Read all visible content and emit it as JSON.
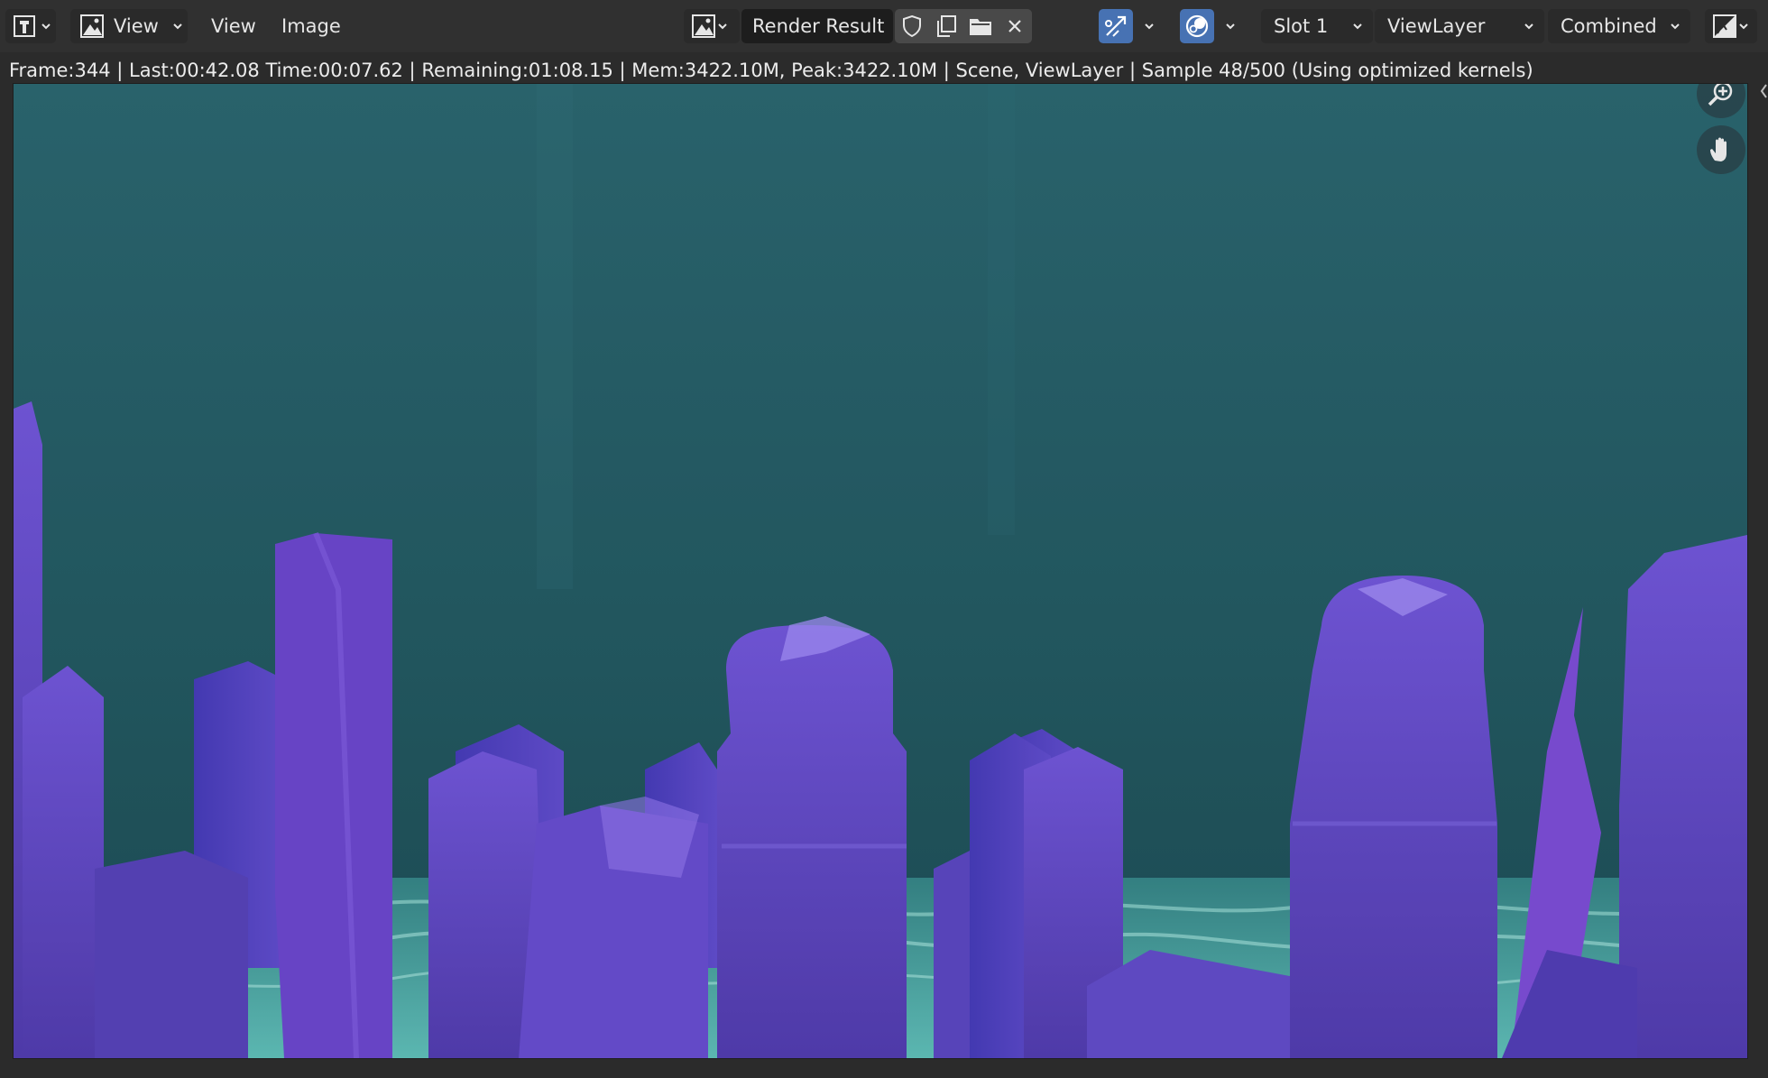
{
  "header": {
    "editor_type_icon": "image-editor-icon",
    "mode_icon": "image-mode-icon",
    "mode_label": "View",
    "menus": [
      "View",
      "Image"
    ],
    "image_browse_icon": "image-browse-icon",
    "image_name": "Render Result",
    "fake_user_icon": "shield-icon",
    "duplicate_icon": "duplicate-icon",
    "open_icon": "folder-icon",
    "unlink_icon": "close-icon",
    "gizmo_toggle_icon": "gizmo-icon",
    "overlay_toggle_icon": "overlay-icon",
    "slot": "Slot 1",
    "view_layer": "ViewLayer",
    "pass": "Combined",
    "display_channels_icon": "display-channels-icon"
  },
  "status": {
    "frame": "Frame:344",
    "last": "Last:00:42.08",
    "time": "Time:00:07.62",
    "remaining": "Remaining:01:08.15",
    "mem": "Mem:3422.10M, Peak:3422.10M",
    "scene": "Scene, ViewLayer",
    "sample": "Sample 48/500 (Using optimized kernels)"
  },
  "viewport": {
    "zoom_icon": "zoom-in-icon",
    "pan_icon": "hand-icon"
  },
  "colors": {
    "header_bg": "#303030",
    "button_bg": "#2a2a2a",
    "accent_blue": "#4772b3",
    "sky_teal": "#1f5a63",
    "building_purple": "#5a3fb8",
    "water_cyan": "#3f8f90"
  }
}
